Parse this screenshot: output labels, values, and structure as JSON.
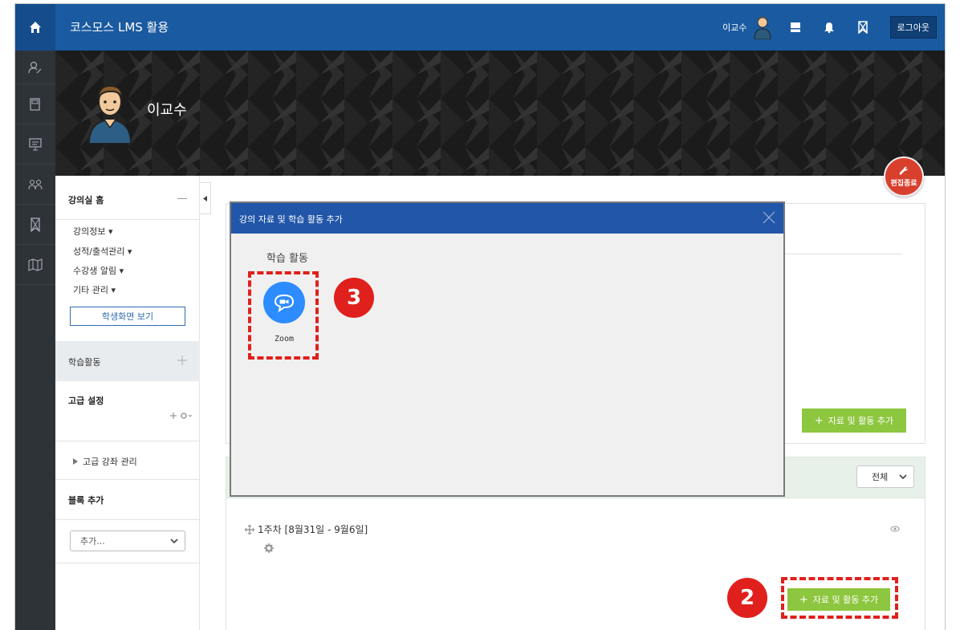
{
  "topbar": {
    "site_title": "코스모스 LMS 활용",
    "user_name": "이교수",
    "logout_label": "로그아웃"
  },
  "hero": {
    "name": "이교수"
  },
  "edit_off_label": "편집종료",
  "blocks": {
    "course_home": "강의실 홈",
    "menu": [
      "강의정보 ▾",
      "성적/출석관리 ▾",
      "수강생 알림 ▾",
      "기타 관리 ▾"
    ],
    "student_view": "학생화면 보기",
    "activities": "학습활동",
    "advanced": "고급 설정",
    "advanced_manage": "고급 강좌 관리",
    "add_block": "블록 추가",
    "add_block_placeholder": "추가..."
  },
  "main": {
    "add_button_label": "자료 및 활동 추가",
    "filter_value": "전체",
    "week_title": "1주차 [8월31일 - 9월6일]"
  },
  "modal": {
    "title": "강의 자료 및 학습 활동 추가",
    "section_label": "학습 활동",
    "zoom_label": "Zoom"
  },
  "annotations": {
    "badge_3": "3",
    "badge_2": "2"
  },
  "colors": {
    "topbar": "#1a5aa0",
    "rail": "#2e3338",
    "accent_green": "#8dc63f",
    "modal_header": "#2256a8",
    "zoom_blue": "#2d8cff",
    "annotation_red": "#e0201c",
    "edit_off_red": "#d8402d"
  }
}
